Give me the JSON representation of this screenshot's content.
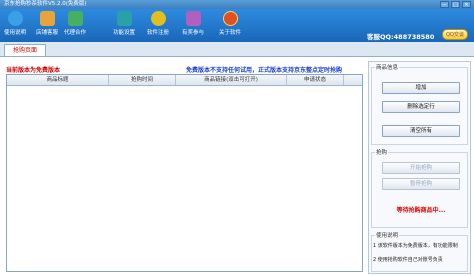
{
  "window": {
    "title": "京东抢购秒杀软件V5.2.0(免费版)",
    "controls": [
      "—",
      "□",
      "✕"
    ]
  },
  "toolbar": {
    "items": [
      {
        "label": "使用说明",
        "color": "#3aa0e8"
      },
      {
        "label": "店铺客服",
        "color": "#e8a33a"
      },
      {
        "label": "代理合作",
        "color": "#44b060"
      },
      {
        "label": "功能设置",
        "color": "#2aa0a8"
      },
      {
        "label": "软件注册",
        "color": "#e0c020"
      },
      {
        "label": "有奖参与",
        "color": "#b060c0"
      },
      {
        "label": "关于软件",
        "color": "#e05020"
      }
    ],
    "service": "客服QQ:488738580",
    "qq_button": "QQ交谈"
  },
  "tabs": [
    {
      "label": "抢购页面"
    }
  ],
  "notices": {
    "left": "当前版本为免费版本",
    "right": "免费版本不支持任何试用，正式版本支持京东整点定时抢购"
  },
  "table": {
    "columns": [
      "商品标题",
      "抢购时间",
      "商品链接(双击可打开)",
      "申请状态"
    ],
    "rows": []
  },
  "panel": {
    "goods_group_title": "商品信息",
    "buttons": [
      "增加",
      "删除选定行",
      "清空所有"
    ],
    "rush_group_title": "抢购",
    "rush_buttons": [
      "开始抢购",
      "暂停抢购"
    ],
    "status": "等待抢购商品中...",
    "usage_title": "使用说明",
    "usage_lines": [
      "1 该软件版本为免费版本，有功能限制",
      "2 使用抢购软件自己对账号负责"
    ]
  },
  "colors": {
    "accent": "#1f74c8",
    "notice_red": "#d00000",
    "notice_blue": "#1a3fd0"
  }
}
